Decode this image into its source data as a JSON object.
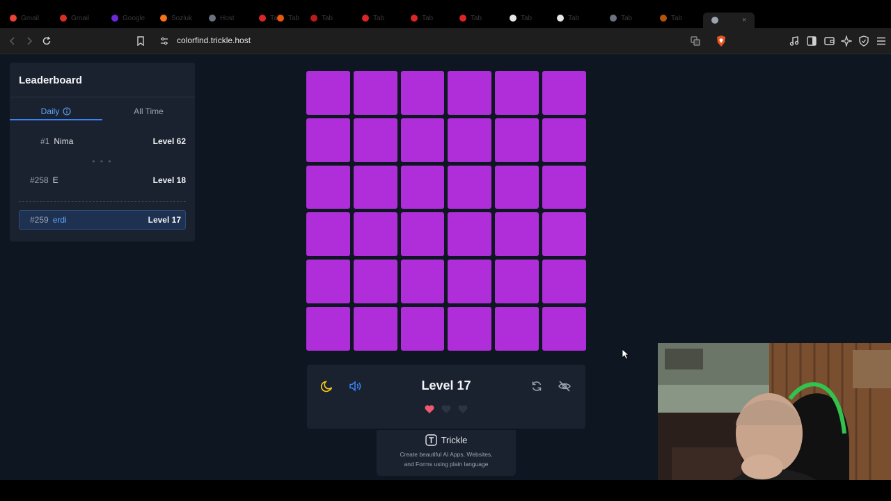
{
  "browser": {
    "tabs": [
      {
        "label": "Gmail",
        "color": "#ea4335"
      },
      {
        "label": "Gmail",
        "color": "#d93025"
      },
      {
        "label": "Google",
        "color": "#6d28d9"
      },
      {
        "label": "Sozluk",
        "color": "#f97316"
      },
      {
        "label": "Host",
        "color": "#6b7280"
      },
      {
        "label": "Tab",
        "color": "#dc2626"
      },
      {
        "label": "Tab",
        "color": "#ea580c"
      },
      {
        "label": "Tab",
        "color": "#b91c1c"
      },
      {
        "label": "Tab",
        "color": "#dc2626"
      },
      {
        "label": "Tab",
        "color": "#dc2626"
      },
      {
        "label": "Tab",
        "color": "#dc2626"
      },
      {
        "label": "Tab",
        "color": "#e5e7eb"
      },
      {
        "label": "Tab",
        "color": "#e5e7eb"
      },
      {
        "label": "Tab",
        "color": "#6b7280"
      },
      {
        "label": "Tab",
        "color": "#b45309"
      }
    ],
    "url": "colorfind.trickle.host"
  },
  "leaderboard": {
    "title": "Leaderboard",
    "tabs": {
      "daily": "Daily",
      "all_time": "All Time"
    },
    "rows": [
      {
        "rank": "#1",
        "name": "Nima",
        "level": "Level 62"
      },
      {
        "rank": "#258",
        "name": "E",
        "level": "Level 18"
      }
    ],
    "dots": "• • •",
    "me": {
      "rank": "#259",
      "name": "erdi",
      "level": "Level 17"
    }
  },
  "game": {
    "cell_color": "#b02ed9",
    "odd_cell": {
      "row": 4,
      "col": 6
    },
    "level_label": "Level 17",
    "lives_total": 3,
    "lives_remaining": 1
  },
  "promo": {
    "brand": "Trickle",
    "line1": "Create beautiful AI Apps, Websites,",
    "line2": "and Forms using plain language"
  }
}
